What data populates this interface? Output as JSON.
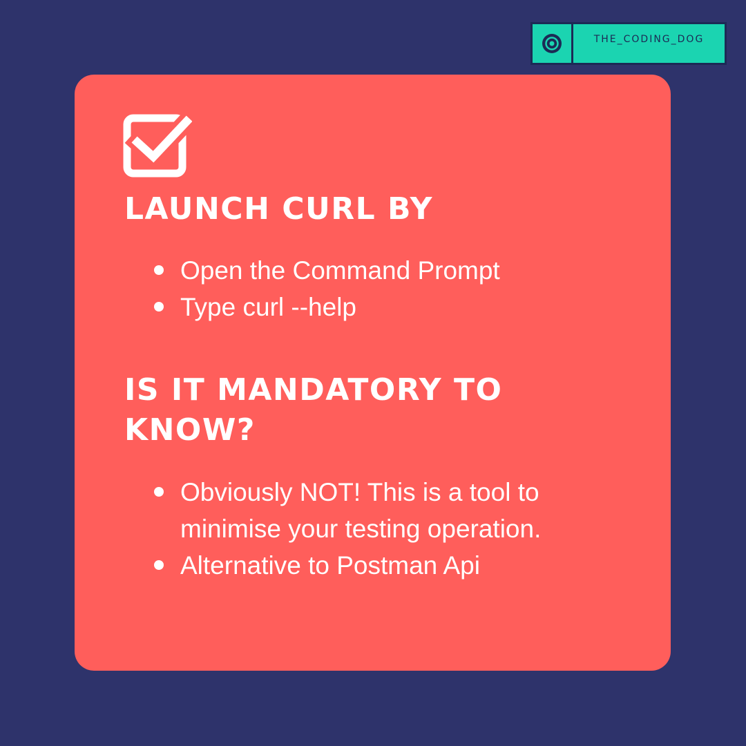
{
  "brand": {
    "name": "THE_CODING_DOG",
    "icon": "target-icon"
  },
  "card": {
    "icon": "checkbox-checked-icon",
    "section_1": {
      "heading": "LAUNCH CURL BY",
      "items": [
        "Open the Command Prompt",
        "Type curl --help"
      ]
    },
    "section_2": {
      "heading": "IS IT MANDATORY TO KNOW?",
      "items": [
        "Obviously NOT! This is a tool to minimise your testing operation.",
        "Alternative to Postman Api"
      ]
    }
  },
  "colors": {
    "background": "#2e336b",
    "card": "#ff5e5b",
    "badge": "#1bd4b1",
    "badge_border": "#1c2a55",
    "text": "#ffffff"
  }
}
